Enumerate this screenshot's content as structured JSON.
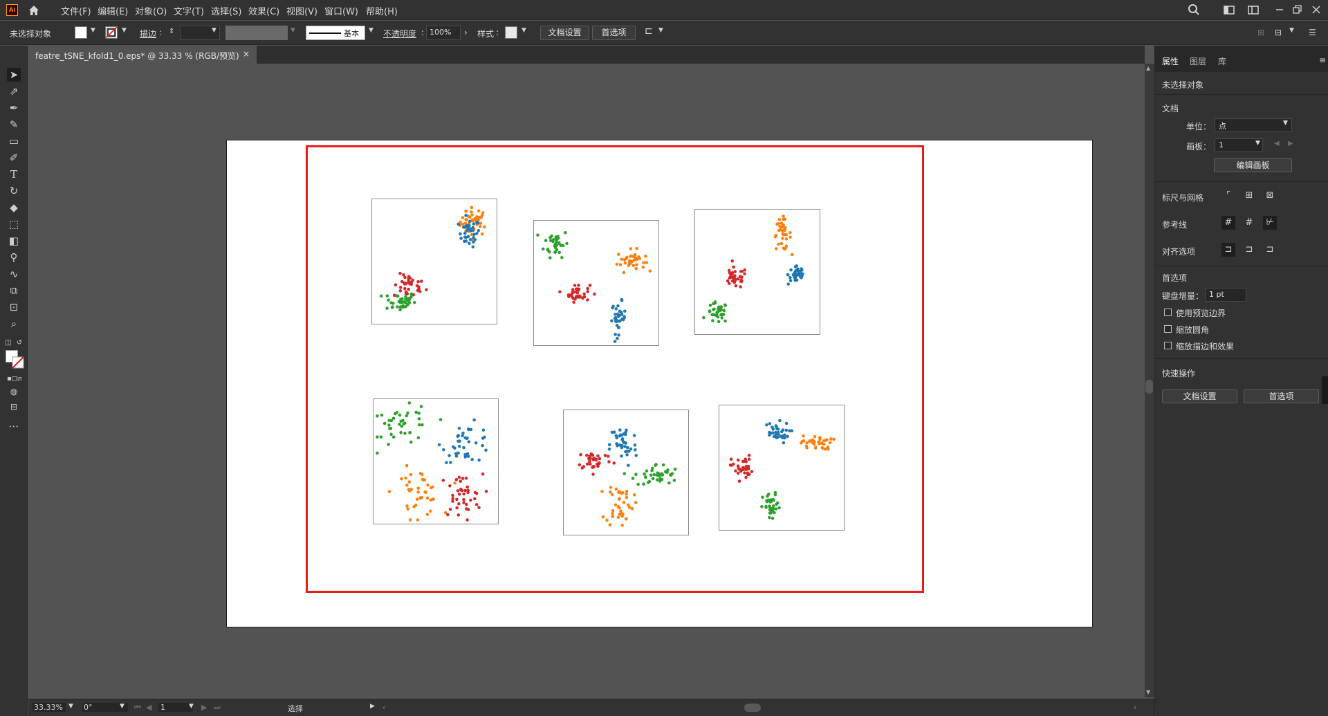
{
  "app": {
    "logo_text": "Ai"
  },
  "menubar": {
    "items": [
      "文件(F)",
      "编辑(E)",
      "对象(O)",
      "文字(T)",
      "选择(S)",
      "效果(C)",
      "视图(V)",
      "窗口(W)",
      "帮助(H)"
    ]
  },
  "control_bar": {
    "selection_status": "未选择对象",
    "stroke_label": "描边",
    "stroke_profile": "基本",
    "opacity_label": "不透明度",
    "opacity_value": "100%",
    "style_label": "样式",
    "doc_setup_button": "文档设置",
    "prefs_button": "首选项"
  },
  "document_tab": {
    "title": "featre_tSNE_kfold1_0.eps* @ 33.33 % (RGB/预览)",
    "close": "×"
  },
  "status_bar": {
    "zoom": "33.33%",
    "rotation": "0°",
    "artboard_number": "1",
    "tool_name": "选择"
  },
  "right_panel": {
    "tabs": [
      "属性",
      "图层",
      "库"
    ],
    "selection_status": "未选择对象",
    "document_section": "文档",
    "unit_label": "单位：",
    "unit_value": "点",
    "artboard_label": "画板：",
    "artboard_value": "1",
    "edit_artboards_button": "编辑画板",
    "rulers_grids_label": "标尺与网格",
    "guides_label": "参考线",
    "snap_options_label": "对齐选项",
    "preferences_section": "首选项",
    "keyboard_increment_label": "键盘增量：",
    "keyboard_increment_value": "1 pt",
    "checkboxes": [
      "使用预览边界",
      "缩放圆角",
      "缩放描边和效果"
    ],
    "quick_actions_section": "快速操作",
    "quick_doc_setup_button": "文档设置",
    "quick_prefs_button": "首选项"
  },
  "colors": {
    "series_blue": "#1f77b4",
    "series_orange": "#ff7f0e",
    "series_green": "#2ca02c",
    "series_red": "#d62728",
    "selection_red": "#e81a1a"
  },
  "chart_data": [
    {
      "type": "scatter",
      "clusters": [
        {
          "color": "series_orange",
          "cx": 0.82,
          "cy": 0.82,
          "spread": 0.08,
          "n": 40,
          "elong": [
            0.7,
            0.7
          ]
        },
        {
          "color": "series_blue",
          "cx": 0.78,
          "cy": 0.73,
          "spread": 0.07,
          "n": 35,
          "elong": [
            0.6,
            0.8
          ]
        },
        {
          "color": "series_red",
          "cx": 0.3,
          "cy": 0.3,
          "spread": 0.08,
          "n": 35,
          "elong": [
            0.8,
            0.6
          ]
        },
        {
          "color": "series_green",
          "cx": 0.22,
          "cy": 0.18,
          "spread": 0.08,
          "n": 40,
          "elong": [
            0.8,
            0.5
          ]
        }
      ]
    },
    {
      "type": "scatter",
      "clusters": [
        {
          "color": "series_green",
          "cx": 0.18,
          "cy": 0.82,
          "spread": 0.07,
          "n": 35,
          "elong": [
            0.7,
            0.8
          ]
        },
        {
          "color": "series_orange",
          "cx": 0.78,
          "cy": 0.68,
          "spread": 0.07,
          "n": 35,
          "elong": [
            0.8,
            0.6
          ]
        },
        {
          "color": "series_red",
          "cx": 0.35,
          "cy": 0.42,
          "spread": 0.07,
          "n": 35,
          "elong": [
            0.7,
            0.5
          ]
        },
        {
          "color": "series_blue",
          "cx": 0.68,
          "cy": 0.22,
          "spread": 0.07,
          "n": 35,
          "elong": [
            0.4,
            0.9
          ]
        }
      ]
    },
    {
      "type": "scatter",
      "clusters": [
        {
          "color": "series_orange",
          "cx": 0.7,
          "cy": 0.8,
          "spread": 0.07,
          "n": 35,
          "elong": [
            0.5,
            0.9
          ]
        },
        {
          "color": "series_blue",
          "cx": 0.82,
          "cy": 0.48,
          "spread": 0.06,
          "n": 35,
          "elong": [
            0.6,
            0.7
          ]
        },
        {
          "color": "series_red",
          "cx": 0.32,
          "cy": 0.45,
          "spread": 0.07,
          "n": 35,
          "elong": [
            0.7,
            0.6
          ]
        },
        {
          "color": "series_green",
          "cx": 0.18,
          "cy": 0.17,
          "spread": 0.06,
          "n": 35,
          "elong": [
            0.7,
            0.7
          ]
        }
      ]
    },
    {
      "type": "scatter",
      "clusters": [
        {
          "color": "series_green",
          "cx": 0.25,
          "cy": 0.78,
          "spread": 0.12,
          "n": 40,
          "elong": [
            1.0,
            0.7
          ]
        },
        {
          "color": "series_blue",
          "cx": 0.75,
          "cy": 0.65,
          "spread": 0.11,
          "n": 40,
          "elong": [
            0.9,
            0.7
          ]
        },
        {
          "color": "series_orange",
          "cx": 0.35,
          "cy": 0.25,
          "spread": 0.12,
          "n": 40,
          "elong": [
            0.8,
            0.8
          ]
        },
        {
          "color": "series_red",
          "cx": 0.7,
          "cy": 0.22,
          "spread": 0.11,
          "n": 40,
          "elong": [
            0.8,
            0.8
          ]
        }
      ]
    },
    {
      "type": "scatter",
      "clusters": [
        {
          "color": "series_blue",
          "cx": 0.48,
          "cy": 0.72,
          "spread": 0.09,
          "n": 40,
          "elong": [
            0.6,
            1.0
          ]
        },
        {
          "color": "series_red",
          "cx": 0.25,
          "cy": 0.6,
          "spread": 0.08,
          "n": 35,
          "elong": [
            0.9,
            0.5
          ]
        },
        {
          "color": "series_green",
          "cx": 0.75,
          "cy": 0.48,
          "spread": 0.09,
          "n": 40,
          "elong": [
            1.0,
            0.5
          ]
        },
        {
          "color": "series_orange",
          "cx": 0.45,
          "cy": 0.25,
          "spread": 0.09,
          "n": 40,
          "elong": [
            0.6,
            1.0
          ]
        }
      ]
    },
    {
      "type": "scatter",
      "clusters": [
        {
          "color": "series_blue",
          "cx": 0.45,
          "cy": 0.78,
          "spread": 0.07,
          "n": 35,
          "elong": [
            0.8,
            0.6
          ]
        },
        {
          "color": "series_orange",
          "cx": 0.78,
          "cy": 0.7,
          "spread": 0.07,
          "n": 35,
          "elong": [
            0.9,
            0.4
          ]
        },
        {
          "color": "series_red",
          "cx": 0.18,
          "cy": 0.5,
          "spread": 0.07,
          "n": 35,
          "elong": [
            0.6,
            0.7
          ]
        },
        {
          "color": "series_green",
          "cx": 0.42,
          "cy": 0.18,
          "spread": 0.07,
          "n": 35,
          "elong": [
            0.5,
            0.8
          ]
        }
      ]
    }
  ]
}
